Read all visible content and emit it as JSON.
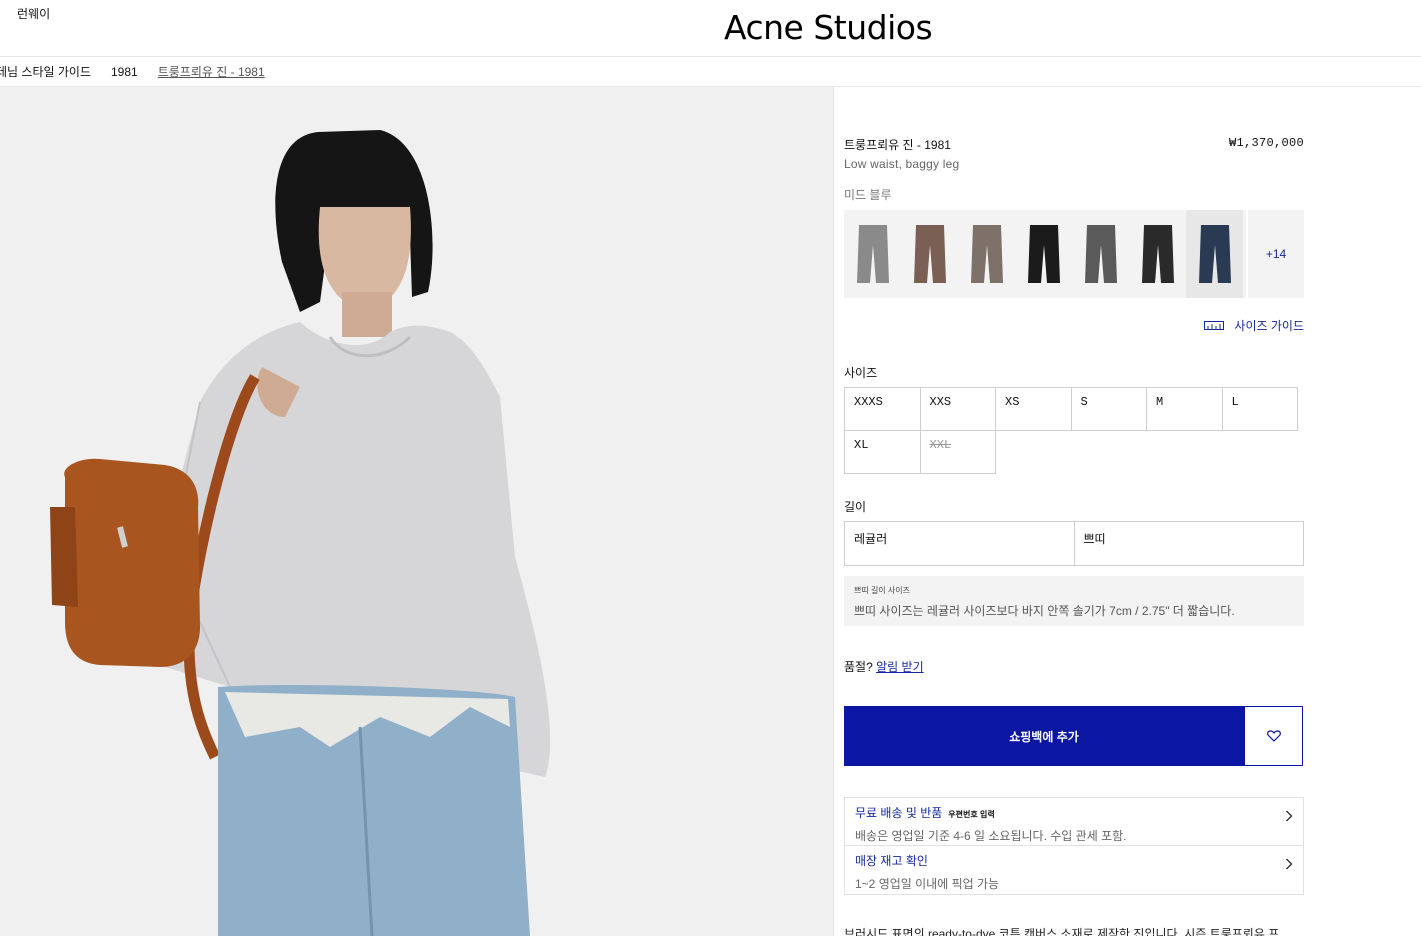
{
  "header": {
    "runway_link": "런웨이",
    "brand": "Acne Studios"
  },
  "breadcrumb": [
    "데님 스타일 가이드",
    "1981",
    "트룽프뢰유 진 - 1981"
  ],
  "product": {
    "name": "트룽프뢰유 진 - 1981",
    "price": "₩1,370,000",
    "subtitle": "Low waist, baggy leg",
    "color_name": "미드 블루",
    "more_colors": "+14",
    "swatch_colors": [
      "#8a8a8a",
      "#7a5f55",
      "#7d716a",
      "#1b1b1b",
      "#5a5a5a",
      "#2a2a2a",
      "#2a3a52"
    ],
    "size_guide": "사이즈 가이드"
  },
  "sizes": {
    "label": "사이즈",
    "options": [
      "XXXS",
      "XXS",
      "XS",
      "S",
      "M",
      "L",
      "XL",
      "XXL"
    ],
    "sold_out": "XXL"
  },
  "length": {
    "label": "길이",
    "options": [
      "레귤러",
      "쁘띠"
    ]
  },
  "petite_note": {
    "title": "쁘띠 길이 사이즈",
    "text": "쁘띠 사이즈는 레귤러 사이즈보다 바지 안쪽 솔기가 7cm / 2.75\" 더 짧습니다."
  },
  "stock": {
    "prefix": "품절?",
    "link": "알림 받기"
  },
  "cart": {
    "add_label": "쇼핑백에 추가"
  },
  "shipping": {
    "title": "무료 배송 및 반품",
    "postcode": "우편번호 입력",
    "text": "배송은 영업일 기준 4-6 일 소요됩니다. 수입 관세 포함."
  },
  "store": {
    "title": "매장 재고 확인",
    "text": "1~2 영업일 이내에 픽업 가능"
  },
  "description": "브러시드 표면의 ready-to-dye 코튼 캔버스 소재로 제작한 진입니다. 시즌 트룽프뢰유 프",
  "colors": {
    "accent": "#0b17a3",
    "link": "#1428a0"
  }
}
